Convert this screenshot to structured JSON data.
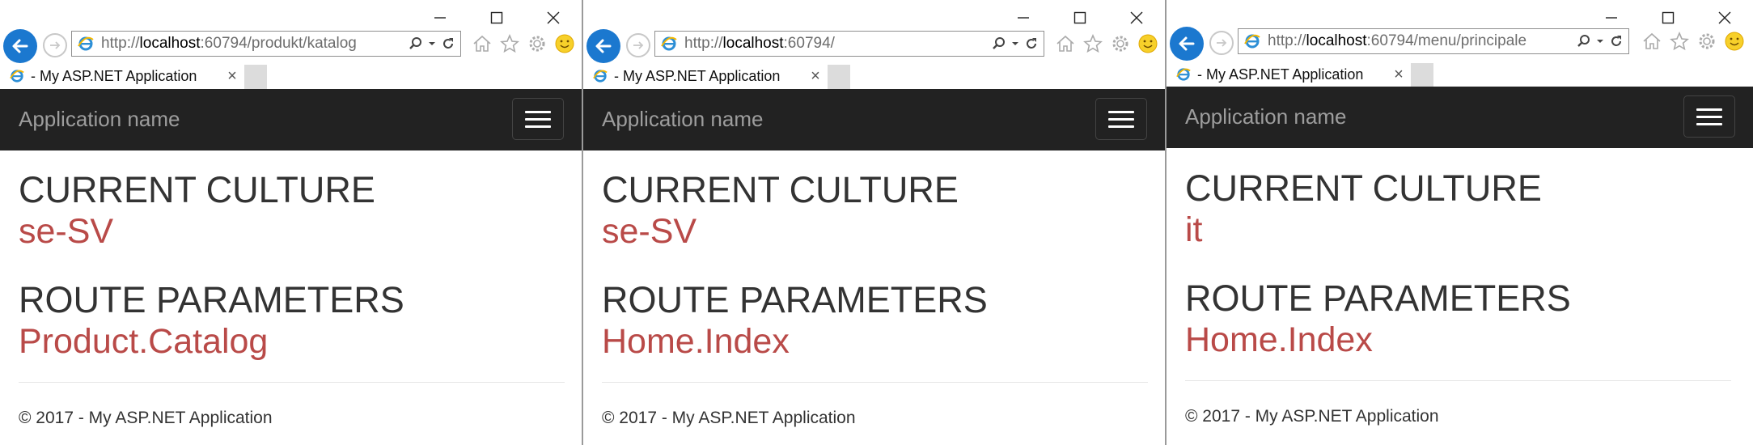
{
  "windows": [
    {
      "url_prefix": "http://",
      "url_host": "localhost",
      "url_path": ":60794/produkt/katalog",
      "tab_title": "- My ASP.NET Application",
      "brand": "Application name",
      "culture_label": "CURRENT CULTURE",
      "culture_value": "se-SV",
      "route_label": "ROUTE PARAMETERS",
      "route_value": "Product.Catalog",
      "footer": "© 2017 - My ASP.NET Application"
    },
    {
      "url_prefix": "http://",
      "url_host": "localhost",
      "url_path": ":60794/",
      "tab_title": "- My ASP.NET Application",
      "brand": "Application name",
      "culture_label": "CURRENT CULTURE",
      "culture_value": "se-SV",
      "route_label": "ROUTE PARAMETERS",
      "route_value": "Home.Index",
      "footer": "© 2017 - My ASP.NET Application"
    },
    {
      "url_prefix": "http://",
      "url_host": "localhost",
      "url_path": ":60794/menu/principale",
      "tab_title": "- My ASP.NET Application",
      "brand": "Application name",
      "culture_label": "CURRENT CULTURE",
      "culture_value": "it",
      "route_label": "ROUTE PARAMETERS",
      "route_value": "Home.Index",
      "footer": "© 2017 - My ASP.NET Application"
    }
  ],
  "icons": {
    "close_tab": "×",
    "minimize": "minimize-icon",
    "maximize": "maximize-icon",
    "close": "close-icon"
  },
  "colors": {
    "navbar": "#222222",
    "brand_text": "#9d9d9d",
    "value_text": "#b94a48",
    "back_button": "#1b78cf"
  }
}
